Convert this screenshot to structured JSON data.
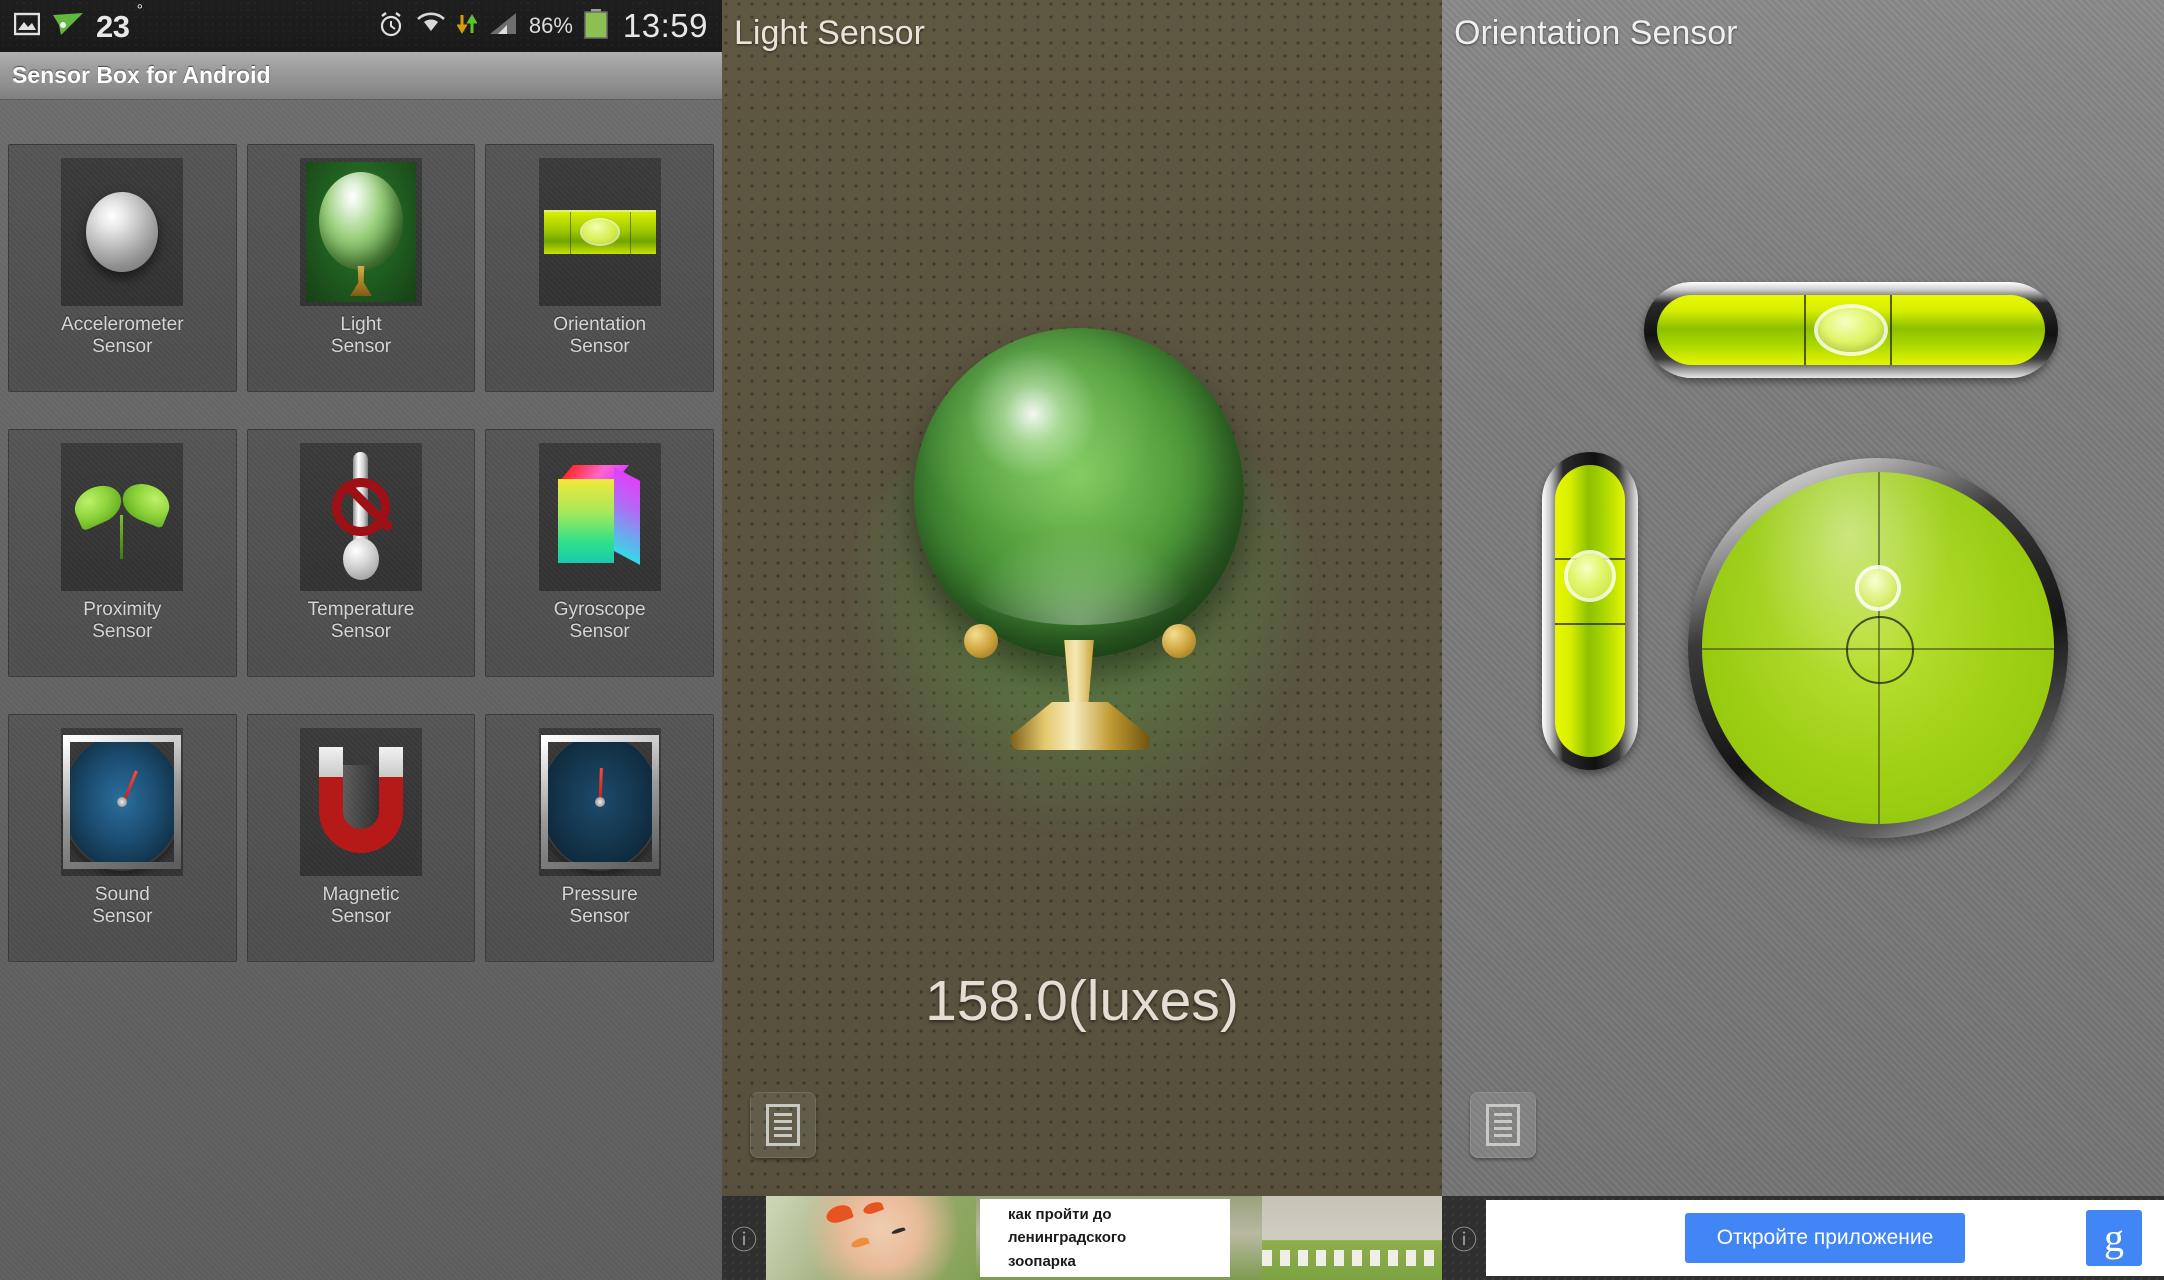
{
  "status_bar": {
    "gallery_icon": "image-icon",
    "navigation_icon": "navigation-arrow-icon",
    "temperature": "23",
    "degree_symbol": "°",
    "alarm_icon": "alarm-clock-icon",
    "wifi_icon": "wifi-icon",
    "data_transfer_icon": "data-updown-icon",
    "signal_icon": "signal-bars-icon",
    "battery_percent": "86%",
    "battery_icon": "battery-icon",
    "time": "13:59"
  },
  "app_bar": {
    "title": "Sensor Box for Android"
  },
  "sensor_grid": {
    "tiles": [
      {
        "label_line1": "Accelerometer",
        "label_line2": "Sensor",
        "icon": "metal-ball-icon"
      },
      {
        "label_line1": "Light",
        "label_line2": "Sensor",
        "icon": "green-globe-lamp-icon"
      },
      {
        "label_line1": "Orientation",
        "label_line2": "Sensor",
        "icon": "spirit-level-icon"
      },
      {
        "label_line1": "Proximity",
        "label_line2": "Sensor",
        "icon": "green-sprout-icon"
      },
      {
        "label_line1": "Temperature",
        "label_line2": "Sensor",
        "icon": "thermometer-disabled-icon"
      },
      {
        "label_line1": "Gyroscope",
        "label_line2": "Sensor",
        "icon": "color-cube-icon"
      },
      {
        "label_line1": "Sound",
        "label_line2": "Sensor",
        "icon": "sound-gauge-icon"
      },
      {
        "label_line1": "Magnetic",
        "label_line2": "Sensor",
        "icon": "horseshoe-magnet-icon"
      },
      {
        "label_line1": "Pressure",
        "label_line2": "Sensor",
        "icon": "pressure-gauge-icon"
      }
    ]
  },
  "light_sensor": {
    "title": "Light Sensor",
    "reading": "158.0(luxes)",
    "memo_icon": "document-list-icon",
    "ad": {
      "info_icon": "info-icon",
      "headline_line1": "как пройти до",
      "headline_line2": "ленинградского",
      "headline_line3": "зоопарка"
    }
  },
  "orientation_sensor": {
    "title": "Orientation Sensor",
    "memo_icon": "document-list-icon",
    "levels": {
      "horizontal_label": "horizontal-bubble-level",
      "vertical_label": "vertical-bubble-level",
      "circular_label": "circular-bubble-level"
    },
    "ad": {
      "info_icon": "info-icon",
      "cta_label": "Откройте приложение",
      "brand_glyph": "g",
      "brand_name": "google-logo-icon"
    }
  },
  "colors": {
    "accent_green": "#9fd014",
    "level_yellow": "#d7ee00",
    "ad_blue": "#4285f4",
    "battery_green": "#8cc152"
  }
}
